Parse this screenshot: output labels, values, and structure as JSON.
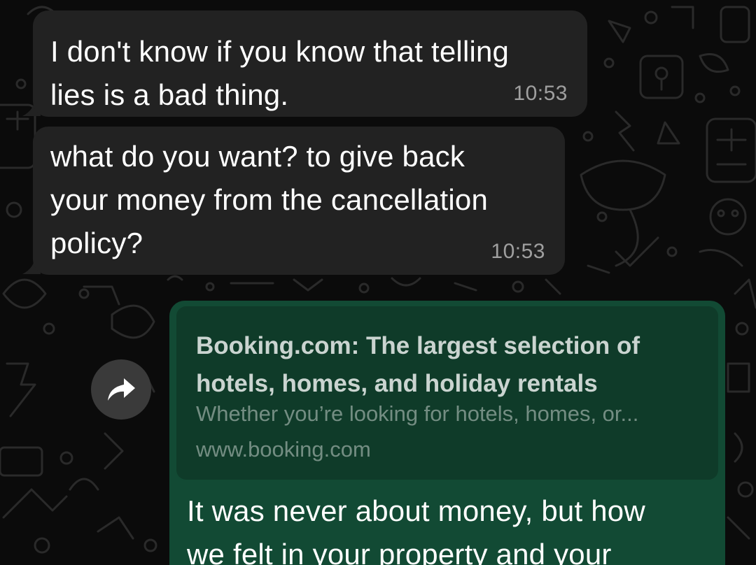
{
  "chat": {
    "messages": [
      {
        "direction": "incoming",
        "lines": [
          "I don't know if you know that telling",
          "lies is a bad thing."
        ],
        "time": "10:53"
      },
      {
        "direction": "incoming",
        "lines": [
          "what do you want? to give back",
          "your money from the cancellation",
          "policy?"
        ],
        "time": "10:53"
      },
      {
        "direction": "outgoing",
        "link_preview": {
          "title_lines": [
            "Booking.com: The largest selection of",
            "hotels, homes, and holiday rentals"
          ],
          "description": "Whether you’re looking for hotels, homes, or...",
          "url": "www.booking.com"
        },
        "lines": [
          "It was never about money, but how",
          "we felt in your property and your"
        ]
      }
    ],
    "forward_icon": "forward-arrow-icon"
  },
  "colors": {
    "background": "#0b0b0b",
    "incoming_bubble": "#222222",
    "outgoing_bubble": "#124a34",
    "link_preview_bg": "#0f3b29",
    "text": "#ffffff",
    "timestamp": "#a8a8a8"
  }
}
